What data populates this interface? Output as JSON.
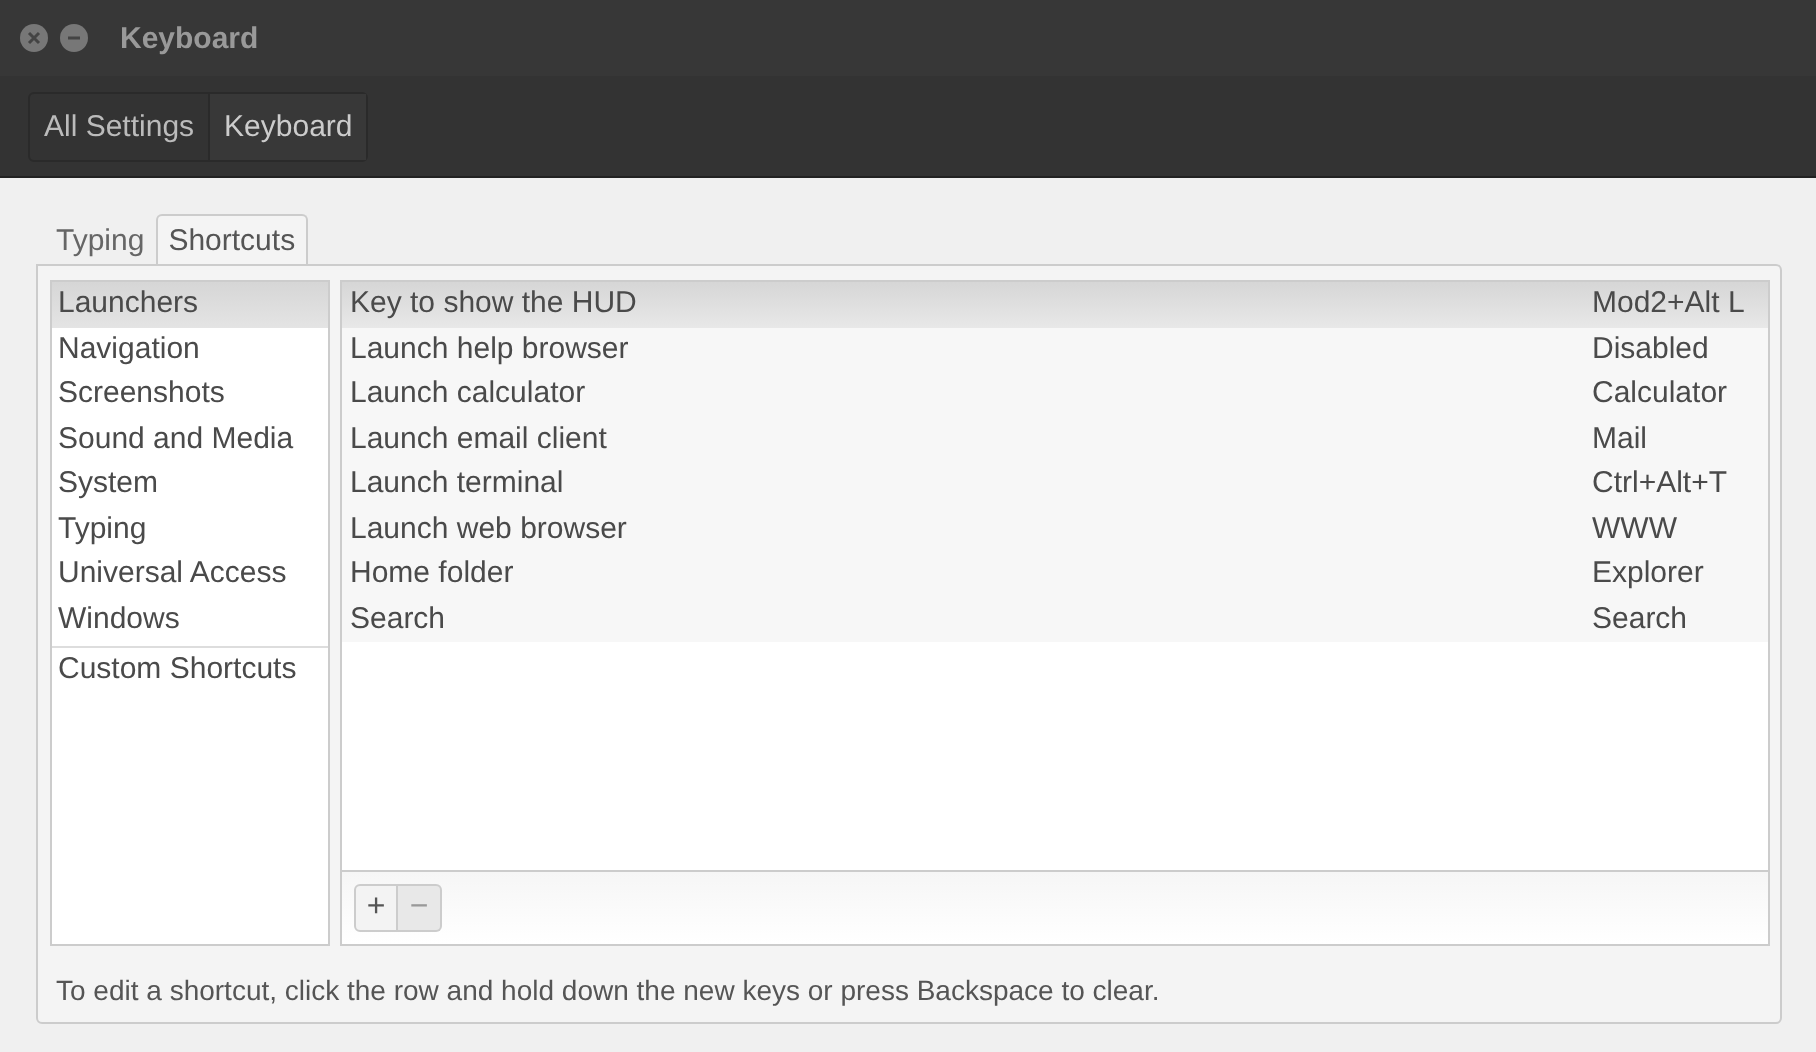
{
  "window": {
    "title": "Keyboard"
  },
  "breadcrumbs": [
    {
      "label": "All Settings",
      "selected": false
    },
    {
      "label": "Keyboard",
      "selected": true
    }
  ],
  "tabs": [
    {
      "label": "Typing",
      "selected": false
    },
    {
      "label": "Shortcuts",
      "selected": true
    }
  ],
  "categories": [
    {
      "label": "Launchers",
      "selected": true
    },
    {
      "label": "Navigation",
      "selected": false
    },
    {
      "label": "Screenshots",
      "selected": false
    },
    {
      "label": "Sound and Media",
      "selected": false
    },
    {
      "label": "System",
      "selected": false
    },
    {
      "label": "Typing",
      "selected": false
    },
    {
      "label": "Universal Access",
      "selected": false
    },
    {
      "label": "Windows",
      "selected": false
    }
  ],
  "custom_category": {
    "label": "Custom Shortcuts",
    "selected": false
  },
  "shortcuts": [
    {
      "action": "Key to show the HUD",
      "keys": "Mod2+Alt L",
      "selected": true
    },
    {
      "action": "Launch help browser",
      "keys": "Disabled",
      "selected": false
    },
    {
      "action": "Launch calculator",
      "keys": "Calculator",
      "selected": false
    },
    {
      "action": "Launch email client",
      "keys": "Mail",
      "selected": false
    },
    {
      "action": "Launch terminal",
      "keys": "Ctrl+Alt+T",
      "selected": false
    },
    {
      "action": "Launch web browser",
      "keys": "WWW",
      "selected": false
    },
    {
      "action": "Home folder",
      "keys": "Explorer",
      "selected": false
    },
    {
      "action": "Search",
      "keys": "Search",
      "selected": false
    }
  ],
  "list_buttons": [
    {
      "label": "+",
      "disabled": false
    },
    {
      "label": "−",
      "disabled": true
    }
  ],
  "hint": "To edit a shortcut, click the row and hold down the new keys or press Backspace to clear."
}
